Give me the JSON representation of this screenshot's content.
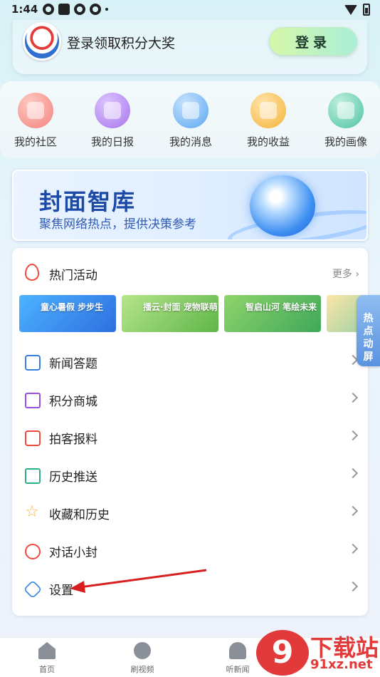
{
  "status_bar": {
    "time": "1:44"
  },
  "login": {
    "prompt": "登录领取积分大奖",
    "button": "登录"
  },
  "quick_menu": [
    {
      "label": "我的社区",
      "icon": "community-icon",
      "color": "#f2837c"
    },
    {
      "label": "我的日报",
      "icon": "daily-report-icon",
      "color": "#a874ec"
    },
    {
      "label": "我的消息",
      "icon": "message-icon",
      "color": "#5aa6f0"
    },
    {
      "label": "我的收益",
      "icon": "earnings-icon",
      "color": "#f5b43a"
    },
    {
      "label": "我的画像",
      "icon": "profile-icon",
      "color": "#4ec3a0"
    }
  ],
  "banner": {
    "title": "封面智库",
    "subtitle": "聚焦网络热点，提供决策参考"
  },
  "hot": {
    "title": "热门活动",
    "more": "更多 ›",
    "thumbs": [
      {
        "text": "童心暑假 步步生",
        "color": "#3a8be8"
      },
      {
        "text": "播云·封面 宠物联萌",
        "color": "#7cc45e"
      },
      {
        "text": "智启山河 笔绘未来",
        "color": "#5fbf63"
      },
      {
        "text": "",
        "color": "#e8c85a"
      }
    ]
  },
  "menu_items": [
    {
      "label": "新闻答题",
      "icon": "quiz-icon",
      "color": "#3a7fe0"
    },
    {
      "label": "积分商城",
      "icon": "shopping-bag-icon",
      "color": "#9a4fe0"
    },
    {
      "label": "拍客报料",
      "icon": "camera-icon",
      "color": "#f04a3e"
    },
    {
      "label": "历史推送",
      "icon": "calendar-icon",
      "color": "#2fae8a"
    },
    {
      "label": "收藏和历史",
      "icon": "star-icon",
      "color": "#f5b43a"
    },
    {
      "label": "对话小封",
      "icon": "chat-bot-icon",
      "color": "#f04a3e"
    },
    {
      "label": "设置",
      "icon": "settings-icon",
      "color": "#3a8be8"
    }
  ],
  "side_tab": {
    "line1": "热",
    "line2": "点",
    "line3": "动",
    "line4": "屏"
  },
  "bottom_nav": [
    {
      "label": "首页",
      "icon": "home-icon"
    },
    {
      "label": "刷视频",
      "icon": "video-play-icon"
    },
    {
      "label": "听新闻",
      "icon": "headphones-icon"
    }
  ],
  "watermark": {
    "logo": "9",
    "title": "下载站",
    "url": "91xz.net"
  }
}
